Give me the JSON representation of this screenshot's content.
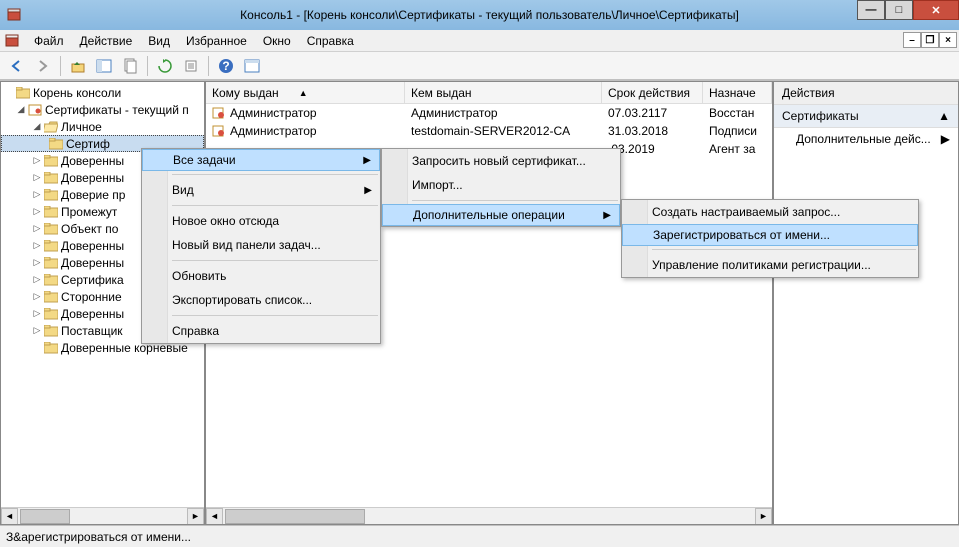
{
  "window": {
    "title": "Консоль1 - [Корень консоли\\Сертификаты - текущий пользователь\\Личное\\Сертификаты]"
  },
  "menu": {
    "file": "Файл",
    "action": "Действие",
    "view": "Вид",
    "favorites": "Избранное",
    "window": "Окно",
    "help": "Справка"
  },
  "tree": {
    "root": "Корень консоли",
    "certs_user": "Сертификаты - текущий п",
    "personal": "Личное",
    "certificates": "Сертиф",
    "items": [
      "Доверенны",
      "Доверенны",
      "Доверие пр",
      "Промежут",
      "Объект по",
      "Доверенны",
      "Доверенны",
      "Сертифика",
      "Сторонние",
      "Доверенны",
      "Поставщик",
      "Доверенные корневые"
    ]
  },
  "columns": {
    "issued_to": "Кому выдан",
    "issued_by": "Кем выдан",
    "expires": "Срок действия",
    "purpose": "Назначе"
  },
  "rows": [
    {
      "to": "Администратор",
      "by": "Администратор",
      "exp": "07.03.2117",
      "purp": "Восстан"
    },
    {
      "to": "Администратор",
      "by": "testdomain-SERVER2012-CA",
      "exp": "31.03.2018",
      "purp": "Подписи"
    },
    {
      "to": "",
      "by": "",
      "exp": ".03.2019",
      "purp": "Агент за"
    }
  ],
  "actions": {
    "header": "Действия",
    "section": "Сертификаты",
    "more": "Дополнительные дейс..."
  },
  "ctx1": {
    "all_tasks": "Все задачи",
    "view": "Вид",
    "new_window": "Новое окно отсюда",
    "new_taskpad": "Новый вид панели задач...",
    "refresh": "Обновить",
    "export": "Экспортировать список...",
    "help": "Справка"
  },
  "ctx2": {
    "request_new": "Запросить новый сертификат...",
    "import": "Импорт...",
    "advanced": "Дополнительные операции"
  },
  "ctx3": {
    "custom_request": "Создать настраиваемый запрос...",
    "enroll_obo": "Зарегистрироваться от имени...",
    "manage_policies": "Управление политиками регистрации..."
  },
  "status": "З&арегистрироваться от имени..."
}
